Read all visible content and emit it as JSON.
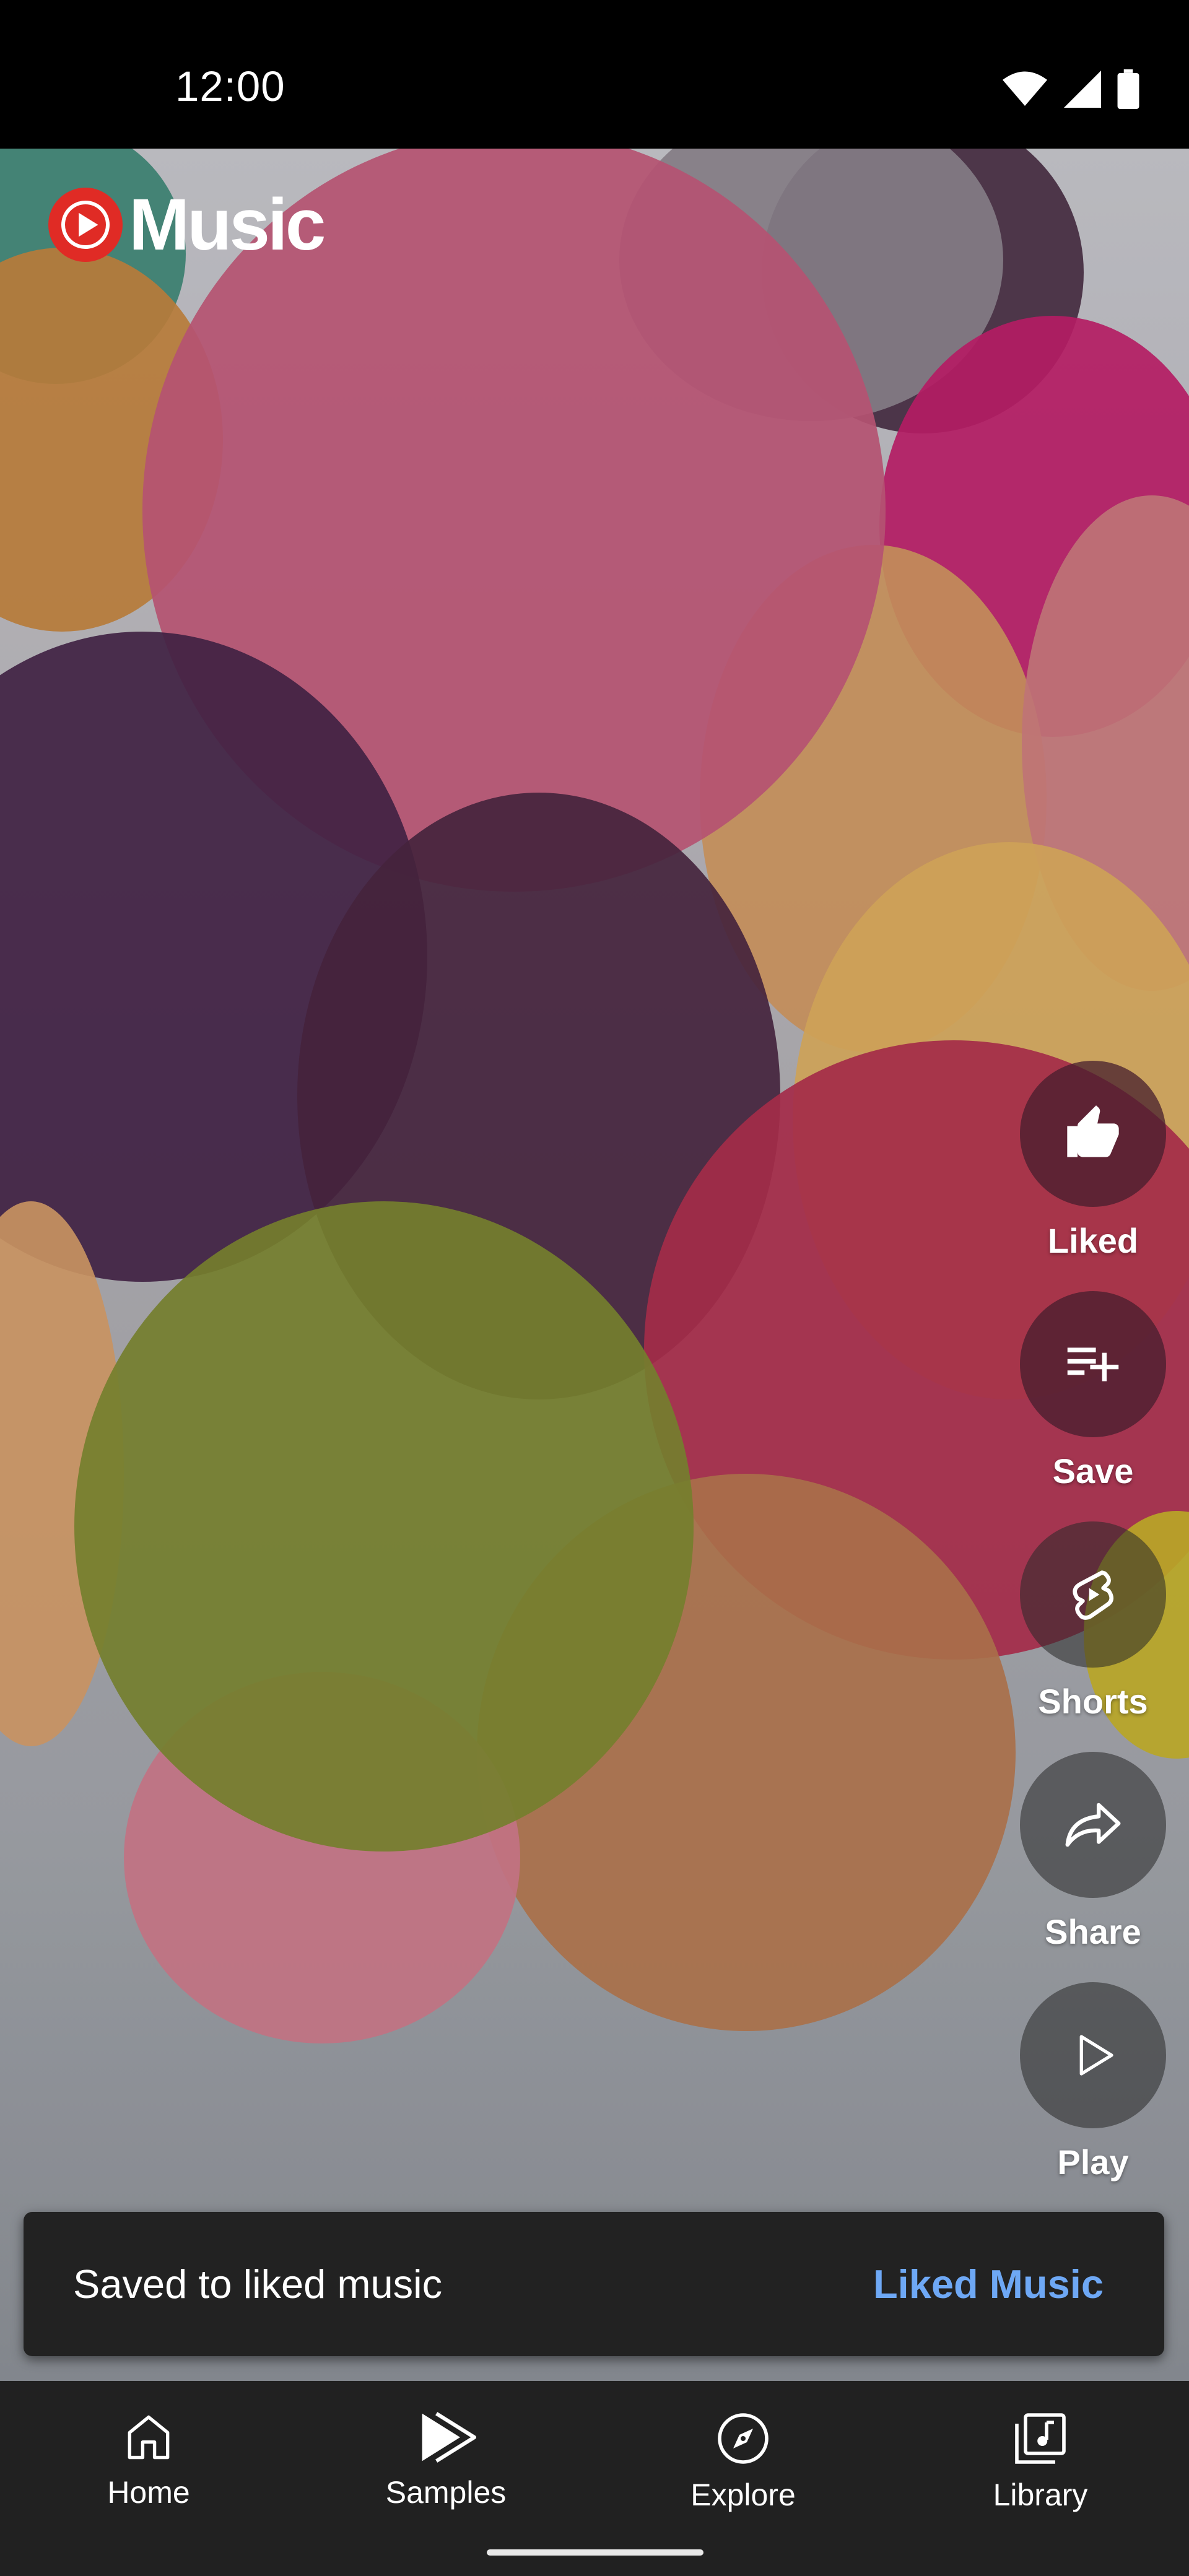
{
  "status_bar": {
    "time": "12:00"
  },
  "app": {
    "logo_text": "Music",
    "logo_color": "#e02b25"
  },
  "actions": [
    {
      "id": "liked",
      "label": "Liked",
      "icon": "thumb-up-filled-icon"
    },
    {
      "id": "save",
      "label": "Save",
      "icon": "playlist-add-icon"
    },
    {
      "id": "shorts",
      "label": "Shorts",
      "icon": "shorts-icon"
    },
    {
      "id": "share",
      "label": "Share",
      "icon": "share-arrow-icon"
    },
    {
      "id": "play",
      "label": "Play",
      "icon": "play-outline-icon"
    }
  ],
  "snackbar": {
    "message": "Saved to liked music",
    "action_label": "Liked Music",
    "action_color": "#6ea8f5"
  },
  "bottom_nav": [
    {
      "label": "Home",
      "icon": "home-icon"
    },
    {
      "label": "Samples",
      "icon": "samples-icon",
      "selected": true
    },
    {
      "label": "Explore",
      "icon": "compass-icon"
    },
    {
      "label": "Library",
      "icon": "library-icon"
    }
  ]
}
